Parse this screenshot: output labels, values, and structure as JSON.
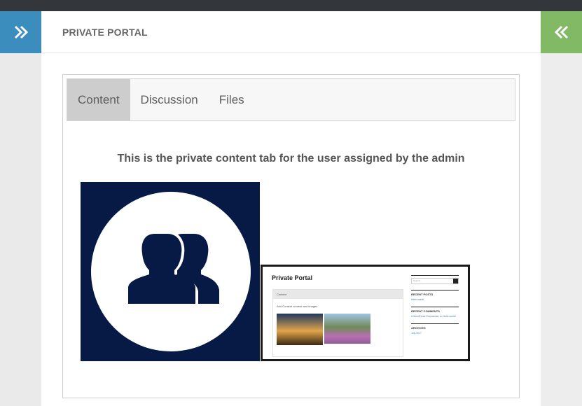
{
  "page": {
    "title": "PRIVATE PORTAL"
  },
  "tabs": [
    {
      "label": "Content",
      "active": true
    },
    {
      "label": "Discussion",
      "active": false
    },
    {
      "label": "Files",
      "active": false
    }
  ],
  "content": {
    "heading": "This is the private content tab for the user assigned by the admin"
  },
  "screenshot": {
    "title": "Private Portal",
    "tab": "Content",
    "text": "Add Content content and images",
    "search_placeholder": "Search...",
    "recent_posts": "RECENT POSTS",
    "recent_posts_item": "Hello world!",
    "recent_comments": "RECENT COMMENTS",
    "recent_comments_item": "A WordPress Commenter on Hello world!",
    "archives": "ARCHIVES",
    "archives_item": "July 2017"
  },
  "icons": {
    "left_toggle": "double-chevron-right-icon",
    "right_toggle": "double-chevron-left-icon",
    "user_group": "user-group-icon"
  },
  "colors": {
    "left_toggle": "#3b8dbd",
    "right_toggle": "#82b965",
    "top_bar": "#33363b",
    "user_image_bg": "#061a45"
  }
}
